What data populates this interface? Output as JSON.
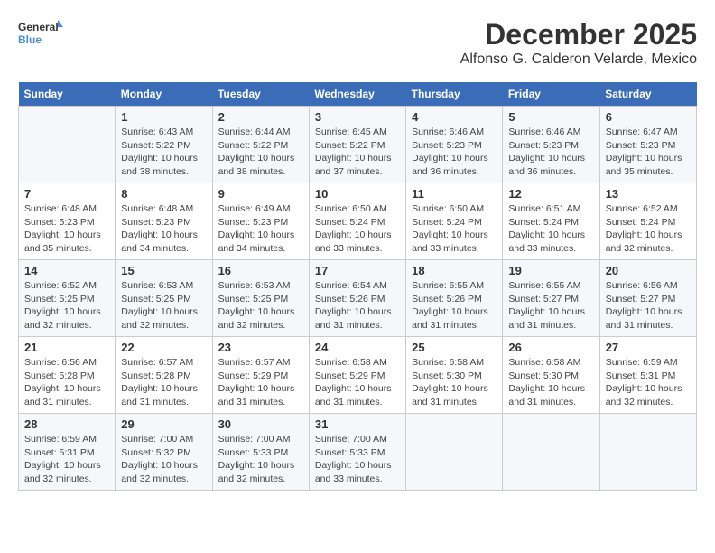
{
  "header": {
    "logo_line1": "General",
    "logo_line2": "Blue",
    "month": "December 2025",
    "location": "Alfonso G. Calderon Velarde, Mexico"
  },
  "days_of_week": [
    "Sunday",
    "Monday",
    "Tuesday",
    "Wednesday",
    "Thursday",
    "Friday",
    "Saturday"
  ],
  "weeks": [
    [
      {
        "day": "",
        "info": ""
      },
      {
        "day": "1",
        "info": "Sunrise: 6:43 AM\nSunset: 5:22 PM\nDaylight: 10 hours\nand 38 minutes."
      },
      {
        "day": "2",
        "info": "Sunrise: 6:44 AM\nSunset: 5:22 PM\nDaylight: 10 hours\nand 38 minutes."
      },
      {
        "day": "3",
        "info": "Sunrise: 6:45 AM\nSunset: 5:22 PM\nDaylight: 10 hours\nand 37 minutes."
      },
      {
        "day": "4",
        "info": "Sunrise: 6:46 AM\nSunset: 5:23 PM\nDaylight: 10 hours\nand 36 minutes."
      },
      {
        "day": "5",
        "info": "Sunrise: 6:46 AM\nSunset: 5:23 PM\nDaylight: 10 hours\nand 36 minutes."
      },
      {
        "day": "6",
        "info": "Sunrise: 6:47 AM\nSunset: 5:23 PM\nDaylight: 10 hours\nand 35 minutes."
      }
    ],
    [
      {
        "day": "7",
        "info": "Sunrise: 6:48 AM\nSunset: 5:23 PM\nDaylight: 10 hours\nand 35 minutes."
      },
      {
        "day": "8",
        "info": "Sunrise: 6:48 AM\nSunset: 5:23 PM\nDaylight: 10 hours\nand 34 minutes."
      },
      {
        "day": "9",
        "info": "Sunrise: 6:49 AM\nSunset: 5:23 PM\nDaylight: 10 hours\nand 34 minutes."
      },
      {
        "day": "10",
        "info": "Sunrise: 6:50 AM\nSunset: 5:24 PM\nDaylight: 10 hours\nand 33 minutes."
      },
      {
        "day": "11",
        "info": "Sunrise: 6:50 AM\nSunset: 5:24 PM\nDaylight: 10 hours\nand 33 minutes."
      },
      {
        "day": "12",
        "info": "Sunrise: 6:51 AM\nSunset: 5:24 PM\nDaylight: 10 hours\nand 33 minutes."
      },
      {
        "day": "13",
        "info": "Sunrise: 6:52 AM\nSunset: 5:24 PM\nDaylight: 10 hours\nand 32 minutes."
      }
    ],
    [
      {
        "day": "14",
        "info": "Sunrise: 6:52 AM\nSunset: 5:25 PM\nDaylight: 10 hours\nand 32 minutes."
      },
      {
        "day": "15",
        "info": "Sunrise: 6:53 AM\nSunset: 5:25 PM\nDaylight: 10 hours\nand 32 minutes."
      },
      {
        "day": "16",
        "info": "Sunrise: 6:53 AM\nSunset: 5:25 PM\nDaylight: 10 hours\nand 32 minutes."
      },
      {
        "day": "17",
        "info": "Sunrise: 6:54 AM\nSunset: 5:26 PM\nDaylight: 10 hours\nand 31 minutes."
      },
      {
        "day": "18",
        "info": "Sunrise: 6:55 AM\nSunset: 5:26 PM\nDaylight: 10 hours\nand 31 minutes."
      },
      {
        "day": "19",
        "info": "Sunrise: 6:55 AM\nSunset: 5:27 PM\nDaylight: 10 hours\nand 31 minutes."
      },
      {
        "day": "20",
        "info": "Sunrise: 6:56 AM\nSunset: 5:27 PM\nDaylight: 10 hours\nand 31 minutes."
      }
    ],
    [
      {
        "day": "21",
        "info": "Sunrise: 6:56 AM\nSunset: 5:28 PM\nDaylight: 10 hours\nand 31 minutes."
      },
      {
        "day": "22",
        "info": "Sunrise: 6:57 AM\nSunset: 5:28 PM\nDaylight: 10 hours\nand 31 minutes."
      },
      {
        "day": "23",
        "info": "Sunrise: 6:57 AM\nSunset: 5:29 PM\nDaylight: 10 hours\nand 31 minutes."
      },
      {
        "day": "24",
        "info": "Sunrise: 6:58 AM\nSunset: 5:29 PM\nDaylight: 10 hours\nand 31 minutes."
      },
      {
        "day": "25",
        "info": "Sunrise: 6:58 AM\nSunset: 5:30 PM\nDaylight: 10 hours\nand 31 minutes."
      },
      {
        "day": "26",
        "info": "Sunrise: 6:58 AM\nSunset: 5:30 PM\nDaylight: 10 hours\nand 31 minutes."
      },
      {
        "day": "27",
        "info": "Sunrise: 6:59 AM\nSunset: 5:31 PM\nDaylight: 10 hours\nand 32 minutes."
      }
    ],
    [
      {
        "day": "28",
        "info": "Sunrise: 6:59 AM\nSunset: 5:31 PM\nDaylight: 10 hours\nand 32 minutes."
      },
      {
        "day": "29",
        "info": "Sunrise: 7:00 AM\nSunset: 5:32 PM\nDaylight: 10 hours\nand 32 minutes."
      },
      {
        "day": "30",
        "info": "Sunrise: 7:00 AM\nSunset: 5:33 PM\nDaylight: 10 hours\nand 32 minutes."
      },
      {
        "day": "31",
        "info": "Sunrise: 7:00 AM\nSunset: 5:33 PM\nDaylight: 10 hours\nand 33 minutes."
      },
      {
        "day": "",
        "info": ""
      },
      {
        "day": "",
        "info": ""
      },
      {
        "day": "",
        "info": ""
      }
    ]
  ]
}
